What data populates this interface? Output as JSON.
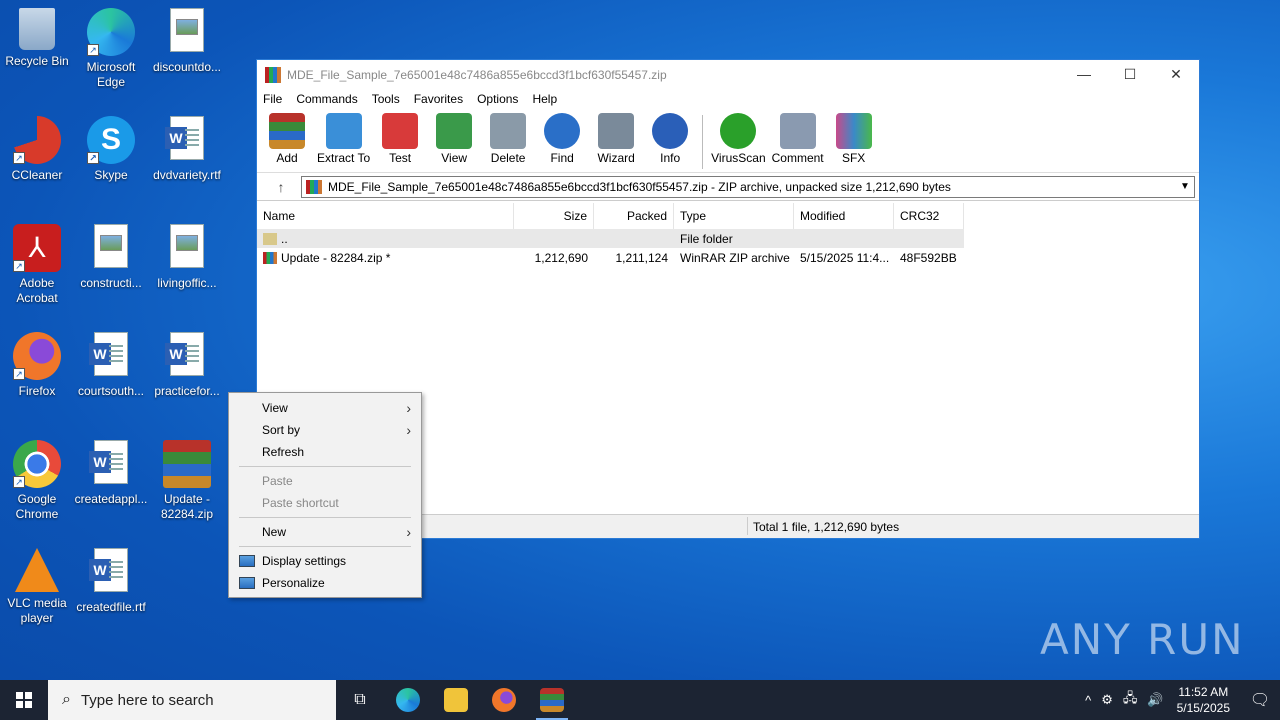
{
  "desktop": {
    "icons": [
      {
        "label": "Recycle Bin",
        "icon": "recycle-bin-icon"
      },
      {
        "label": "Microsoft Edge",
        "icon": "edge-icon"
      },
      {
        "label": "discountdo...",
        "icon": "image-file-icon"
      },
      {
        "label": "CCleaner",
        "icon": "ccleaner-icon"
      },
      {
        "label": "Skype",
        "icon": "skype-icon"
      },
      {
        "label": "dvdvariety.rtf",
        "icon": "word-doc-icon"
      },
      {
        "label": "Adobe Acrobat",
        "icon": "acrobat-icon"
      },
      {
        "label": "constructi...",
        "icon": "image-file-icon"
      },
      {
        "label": "livingoffic...",
        "icon": "image-file-icon"
      },
      {
        "label": "Firefox",
        "icon": "firefox-icon"
      },
      {
        "label": "courtsouth...",
        "icon": "word-doc-icon"
      },
      {
        "label": "practicefor...",
        "icon": "word-doc-icon"
      },
      {
        "label": "Google Chrome",
        "icon": "chrome-icon"
      },
      {
        "label": "createdappl...",
        "icon": "word-doc-icon"
      },
      {
        "label": "Update - 82284.zip",
        "icon": "winrar-icon"
      },
      {
        "label": "VLC media player",
        "icon": "vlc-icon"
      },
      {
        "label": "createdfile.rtf",
        "icon": "word-doc-icon"
      }
    ]
  },
  "window": {
    "title": "MDE_File_Sample_7e65001e48c7486a855e6bccd3f1bcf630f55457.zip",
    "controls": {
      "minimize": "—",
      "maximize": "☐",
      "close": "✕"
    },
    "menu": [
      "File",
      "Commands",
      "Tools",
      "Favorites",
      "Options",
      "Help"
    ],
    "toolbar": [
      {
        "label": "Add",
        "color": "#c84a2a"
      },
      {
        "label": "Extract To",
        "color": "#3a8fd8"
      },
      {
        "label": "Test",
        "color": "#d83a3a"
      },
      {
        "label": "View",
        "color": "#3a9a4a"
      },
      {
        "label": "Delete",
        "color": "#8a9aa8"
      },
      {
        "label": "Find",
        "color": "#2a6fc8"
      },
      {
        "label": "Wizard",
        "color": "#7a8a9a"
      },
      {
        "label": "Info",
        "color": "#2a5fb8"
      },
      {
        "label": "VirusScan",
        "color": "#2aa02a"
      },
      {
        "label": "Comment",
        "color": "#8a9ab0"
      },
      {
        "label": "SFX",
        "color": "#c84a8a"
      }
    ],
    "address": "MDE_File_Sample_7e65001e48c7486a855e6bccd3f1bcf630f55457.zip - ZIP archive, unpacked size 1,212,690 bytes",
    "columns": {
      "name": "Name",
      "size": "Size",
      "packed": "Packed",
      "type": "Type",
      "modified": "Modified",
      "crc": "CRC32"
    },
    "rows": [
      {
        "name": "..",
        "size": "",
        "packed": "",
        "type": "File folder",
        "modified": "",
        "crc": ""
      },
      {
        "name": "Update - 82284.zip *",
        "size": "1,212,690",
        "packed": "1,211,124",
        "type": "WinRAR ZIP archive",
        "modified": "5/15/2025 11:4...",
        "crc": "48F592BB"
      }
    ],
    "status": "Total 1 file, 1,212,690 bytes"
  },
  "context_menu": {
    "items": [
      {
        "label": "View",
        "submenu": true
      },
      {
        "label": "Sort by",
        "submenu": true
      },
      {
        "label": "Refresh"
      },
      {
        "label": "Paste",
        "disabled": true
      },
      {
        "label": "Paste shortcut",
        "disabled": true
      },
      {
        "label": "New",
        "submenu": true
      },
      {
        "label": "Display settings"
      },
      {
        "label": "Personalize"
      }
    ]
  },
  "watermark": "ANY RUN",
  "taskbar": {
    "search_placeholder": "Type here to search",
    "time": "11:52 AM",
    "date": "5/15/2025"
  }
}
